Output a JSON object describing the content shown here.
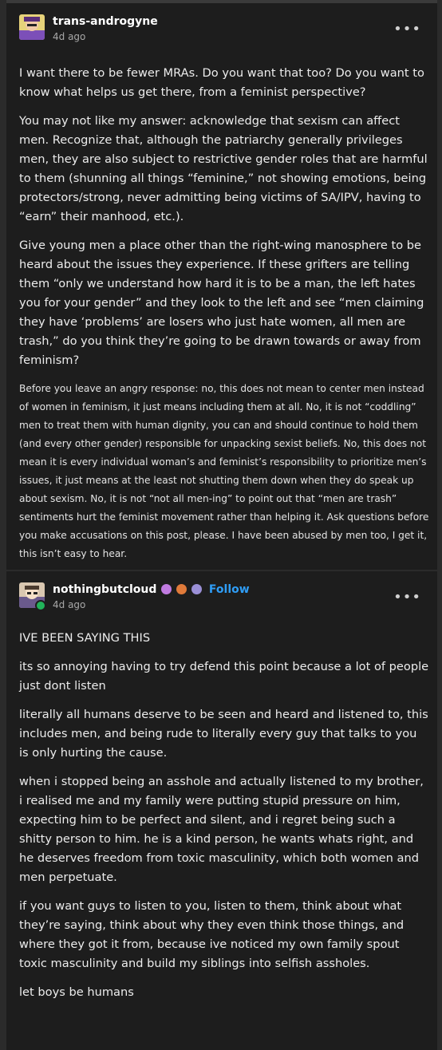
{
  "post1": {
    "username": "trans-androgyne",
    "time": "4d ago",
    "menu_icon": "more-dots-icon",
    "paragraphs": [
      "I want there to be fewer MRAs. Do you want that too? Do you want to know what helps us get there, from a feminist perspective?",
      "You may not like my answer: acknowledge that sexism can affect men. Recognize that, although the patriarchy generally privileges men, they are also subject to restrictive gender roles that are harmful to them (shunning all things “feminine,” not showing emotions, being protectors/strong, never admitting being victims of SA/IPV, having to “earn” their manhood, etc.).",
      "Give young men a place other than the right-wing manosphere to be heard about the issues they experience. If these grifters are telling them “only we understand how hard it is to be a man, the left hates you for your gender” and they look to the left and see “men claiming they have ‘problems’ are losers who just hate women, all men are trash,” do you think they’re going to be drawn towards or away from feminism?"
    ],
    "small_text": "Before you leave an angry response: no, this does not mean to center men instead of women in feminism, it just means including them at all. No, it is not “coddling” men to treat them with human dignity, you can and should continue to hold them (and every other gender) responsible for unpacking sexist beliefs. No, this does not mean it is every individual woman’s and feminist’s responsibility to prioritize men’s issues, it just means at the least not shutting them down when they do speak up about sexism. No, it is not “not all men-ing” to point out that “men are trash” sentiments hurt the feminist movement rather than helping it. Ask questions before you make accusations on this post, please. I have been abused by men too, I get it, this isn’t easy to hear."
  },
  "post2": {
    "username": "nothingbutcloud",
    "follow_label": "Follow",
    "time": "4d ago",
    "menu_icon": "more-dots-icon",
    "badge_colors": [
      "#c07be0",
      "#e07a3a",
      "#9a8fd6"
    ],
    "paragraphs": [
      "IVE BEEN SAYING THIS",
      "its so annoying having to try defend this point because a lot of people just dont listen",
      "literally all humans deserve to be seen and heard and listened to, this includes men, and being rude to literally every guy that talks to you is only hurting the cause.",
      "when i stopped being an asshole and actually listened to my brother, i realised me and my family were putting stupid pressure on him, expecting him to be perfect and silent, and i regret being such a shitty person to him. he is a kind person, he wants whats right, and he deserves freedom from toxic masculinity, which both women and men perpetuate.",
      "if you want guys to listen to you, listen to them, think about what they’re saying, think about why they even think those things, and where they got it from, because ive noticed my own family spout toxic masculinity and build my siblings into selfish assholes.",
      "let boys be humans"
    ]
  }
}
